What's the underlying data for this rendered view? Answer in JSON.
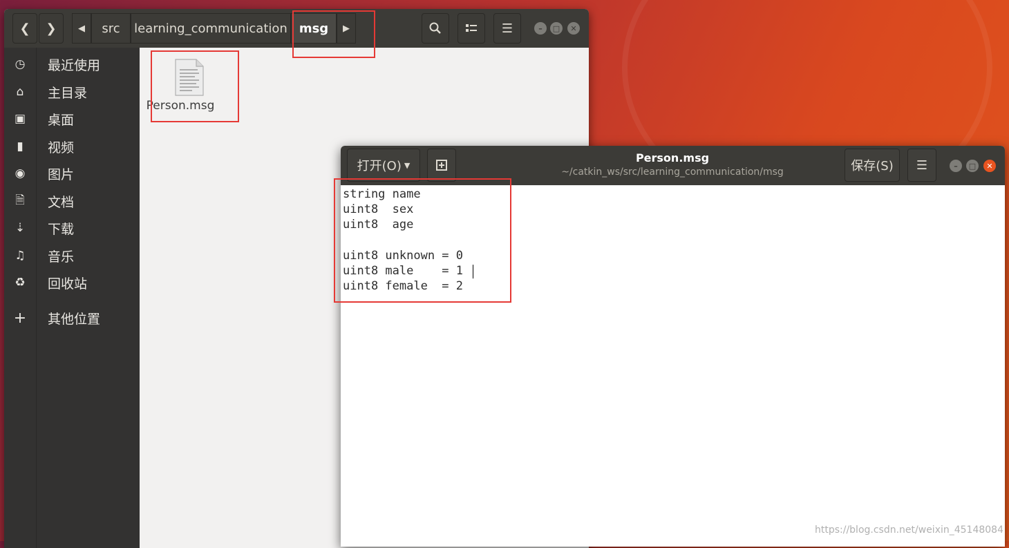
{
  "files_window": {
    "path": [
      "src",
      "learning_communication",
      "msg"
    ],
    "sidebar": [
      {
        "label": "最近使用",
        "icon": "clock-icon"
      },
      {
        "label": "主目录",
        "icon": "home-icon"
      },
      {
        "label": "桌面",
        "icon": "desktop-folder-icon"
      },
      {
        "label": "视频",
        "icon": "video-icon"
      },
      {
        "label": "图片",
        "icon": "camera-icon"
      },
      {
        "label": "文档",
        "icon": "document-icon"
      },
      {
        "label": "下载",
        "icon": "download-icon"
      },
      {
        "label": "音乐",
        "icon": "music-icon"
      },
      {
        "label": "回收站",
        "icon": "trash-icon"
      },
      {
        "label": "其他位置",
        "icon": "plus-icon"
      }
    ],
    "files": [
      {
        "name": "Person.msg",
        "icon": "text-file-icon"
      }
    ]
  },
  "editor": {
    "open_label": "打开(O)",
    "save_label": "保存(S)",
    "title": "Person.msg",
    "subtitle": "~/catkin_ws/src/learning_communication/msg",
    "lines": [
      "string name",
      "uint8  sex",
      "uint8  age",
      "",
      "uint8 unknown = 0",
      "uint8 male    = 1",
      "uint8 female  = 2"
    ]
  },
  "watermark": "https://blog.csdn.net/weixin_45148084",
  "colors": {
    "titlebar": "#3c3b37",
    "sidebar": "#333231",
    "highlight_box": "#e53935",
    "close_button": "#e95420"
  }
}
